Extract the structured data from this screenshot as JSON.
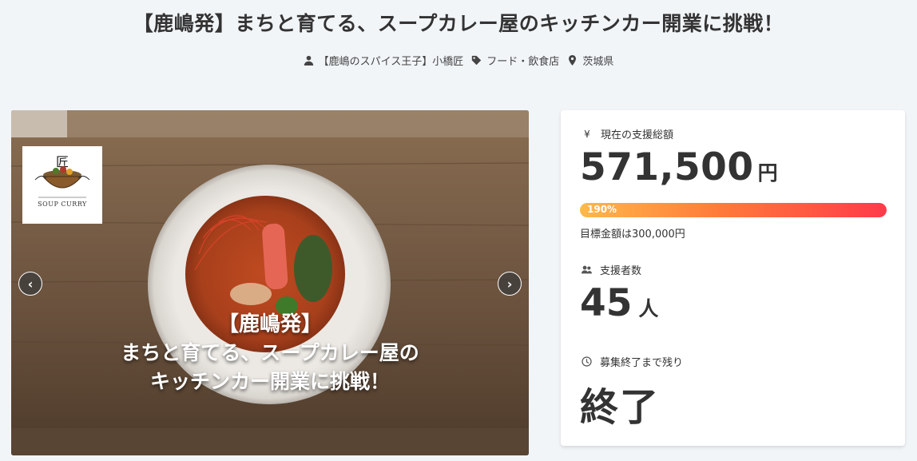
{
  "project": {
    "title": "【鹿嶋発】まちと育てる、スープカレー屋のキッチンカー開業に挑戦！",
    "owner": "【鹿嶋のスパイス王子】小橋匠",
    "category": "フード・飲食店",
    "location": "茨城県"
  },
  "hero": {
    "logo_kanji": "匠",
    "logo_text": "SOUP CURRY",
    "caption_line1": "【鹿嶋発】",
    "caption_line2": "まちと育てる、スープカレー屋の",
    "caption_line3": "キッチンカー開業に挑戦！",
    "prev_label": "‹",
    "next_label": "›"
  },
  "stats": {
    "funding_label": "現在の支援総額",
    "funding_amount": "571,500",
    "funding_unit": "円",
    "progress_text": "190%",
    "progress_percent": 190,
    "goal_text": "目標金額は300,000円",
    "backers_label": "支援者数",
    "backers_count": "45",
    "backers_unit": "人",
    "remaining_label": "募集終了まで残り",
    "remaining_value": "終了",
    "yen_icon_glyph": "¥"
  },
  "colors": {
    "background": "#f2f5f8",
    "progress_start": "#ffb84a",
    "progress_end": "#ff3a4a"
  }
}
